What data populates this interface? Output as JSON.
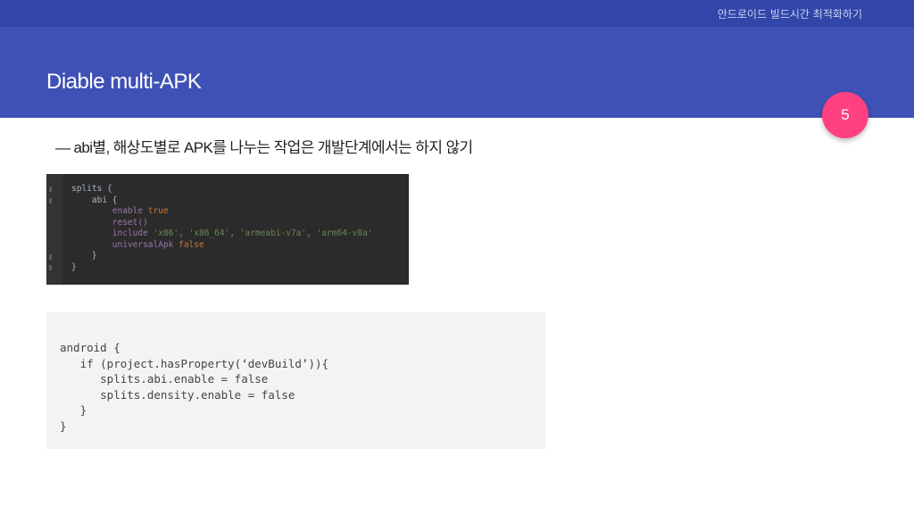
{
  "header": {
    "deck_title": "안드로이드 빌드시간 최적화하기",
    "slide_title": "Diable multi-APK",
    "page_number": "5"
  },
  "bullet": {
    "text": "— abi별, 해상도별로 APK를 나누는 작업은 개발단계에서는 하지 않기"
  },
  "dark_code": {
    "lines": [
      "splits {",
      "    abi {",
      "        enable true",
      "        reset()",
      "        include 'x86', 'x86_64', 'armeabi-v7a', 'arm64-v8a'",
      "        universalApk false",
      "    }",
      "}"
    ]
  },
  "light_code": {
    "lines": [
      "android {",
      "   if (project.hasProperty(‘devBuild’)){",
      "      splits.abi.enable = false",
      "      splits.density.enable = false",
      "   }",
      "}"
    ]
  },
  "colors": {
    "header_bg": "#3f51b5",
    "topbar_bg": "#3146a8",
    "badge_bg": "#ff4081",
    "dark_code_bg": "#2b2b2b",
    "light_code_bg": "#f3f3f3"
  }
}
